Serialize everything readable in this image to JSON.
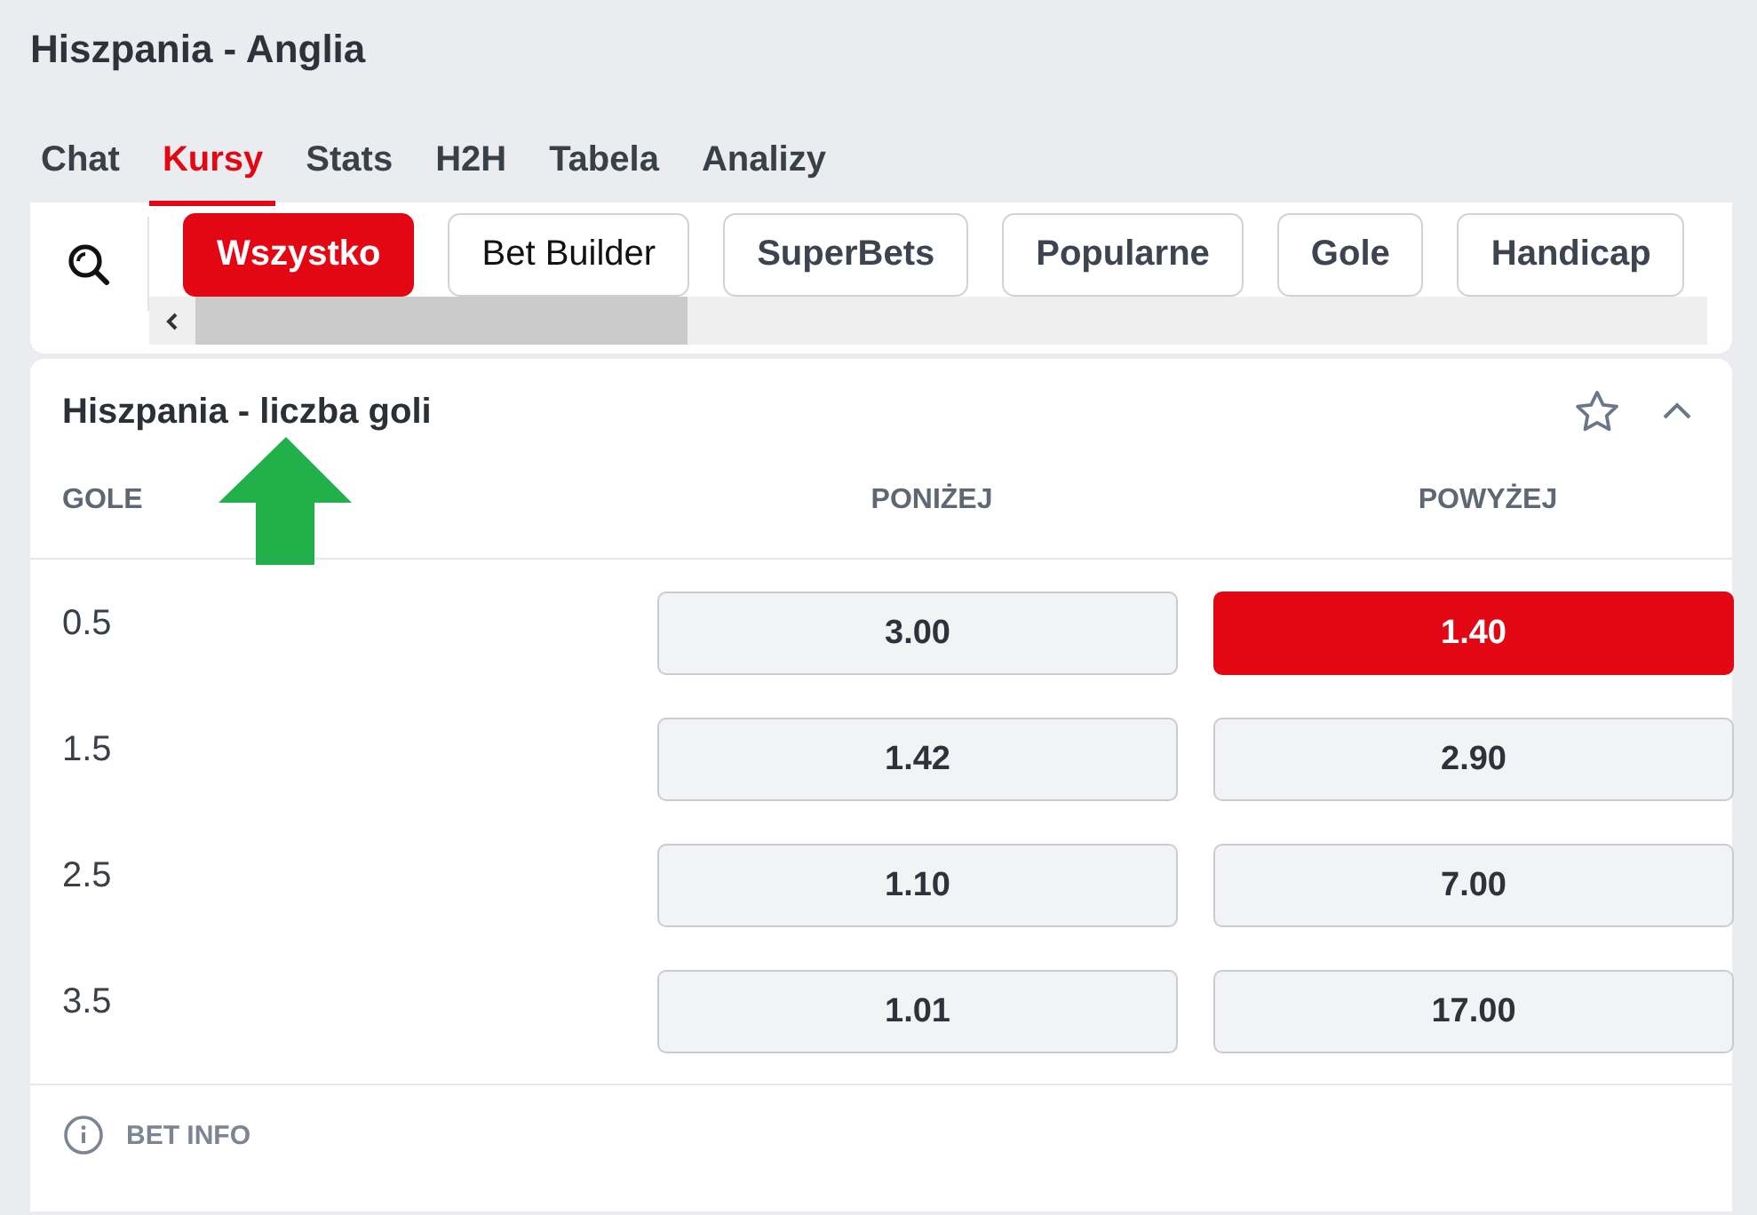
{
  "match_title": "Hiszpania - Anglia",
  "tabs": [
    {
      "label": "Chat",
      "selected": false
    },
    {
      "label": "Kursy",
      "selected": true
    },
    {
      "label": "Stats",
      "selected": false
    },
    {
      "label": "H2H",
      "selected": false
    },
    {
      "label": "Tabela",
      "selected": false
    },
    {
      "label": "Analizy",
      "selected": false
    }
  ],
  "filters": [
    {
      "label": "Wszystko",
      "selected": true,
      "kind": "standard"
    },
    {
      "label": "Bet Builder",
      "selected": false,
      "kind": "builder"
    },
    {
      "label": "SuperBets",
      "selected": false,
      "kind": "standard"
    },
    {
      "label": "Popularne",
      "selected": false,
      "kind": "standard"
    },
    {
      "label": "Gole",
      "selected": false,
      "kind": "standard"
    },
    {
      "label": "Handicap",
      "selected": false,
      "kind": "standard"
    }
  ],
  "market": {
    "title": "Hiszpania - liczba goli",
    "columns": [
      "GOLE",
      "PONIŻEJ",
      "POWYŻEJ"
    ],
    "rows": [
      {
        "line": "0.5",
        "odds": [
          {
            "value": "3.00",
            "selected": false
          },
          {
            "value": "1.40",
            "selected": true
          }
        ]
      },
      {
        "line": "1.5",
        "odds": [
          {
            "value": "1.42",
            "selected": false
          },
          {
            "value": "2.90",
            "selected": false
          }
        ]
      },
      {
        "line": "2.5",
        "odds": [
          {
            "value": "1.10",
            "selected": false
          },
          {
            "value": "7.00",
            "selected": false
          }
        ]
      },
      {
        "line": "3.5",
        "odds": [
          {
            "value": "1.01",
            "selected": false
          },
          {
            "value": "17.00",
            "selected": false
          }
        ]
      }
    ],
    "footer": "BET INFO"
  }
}
